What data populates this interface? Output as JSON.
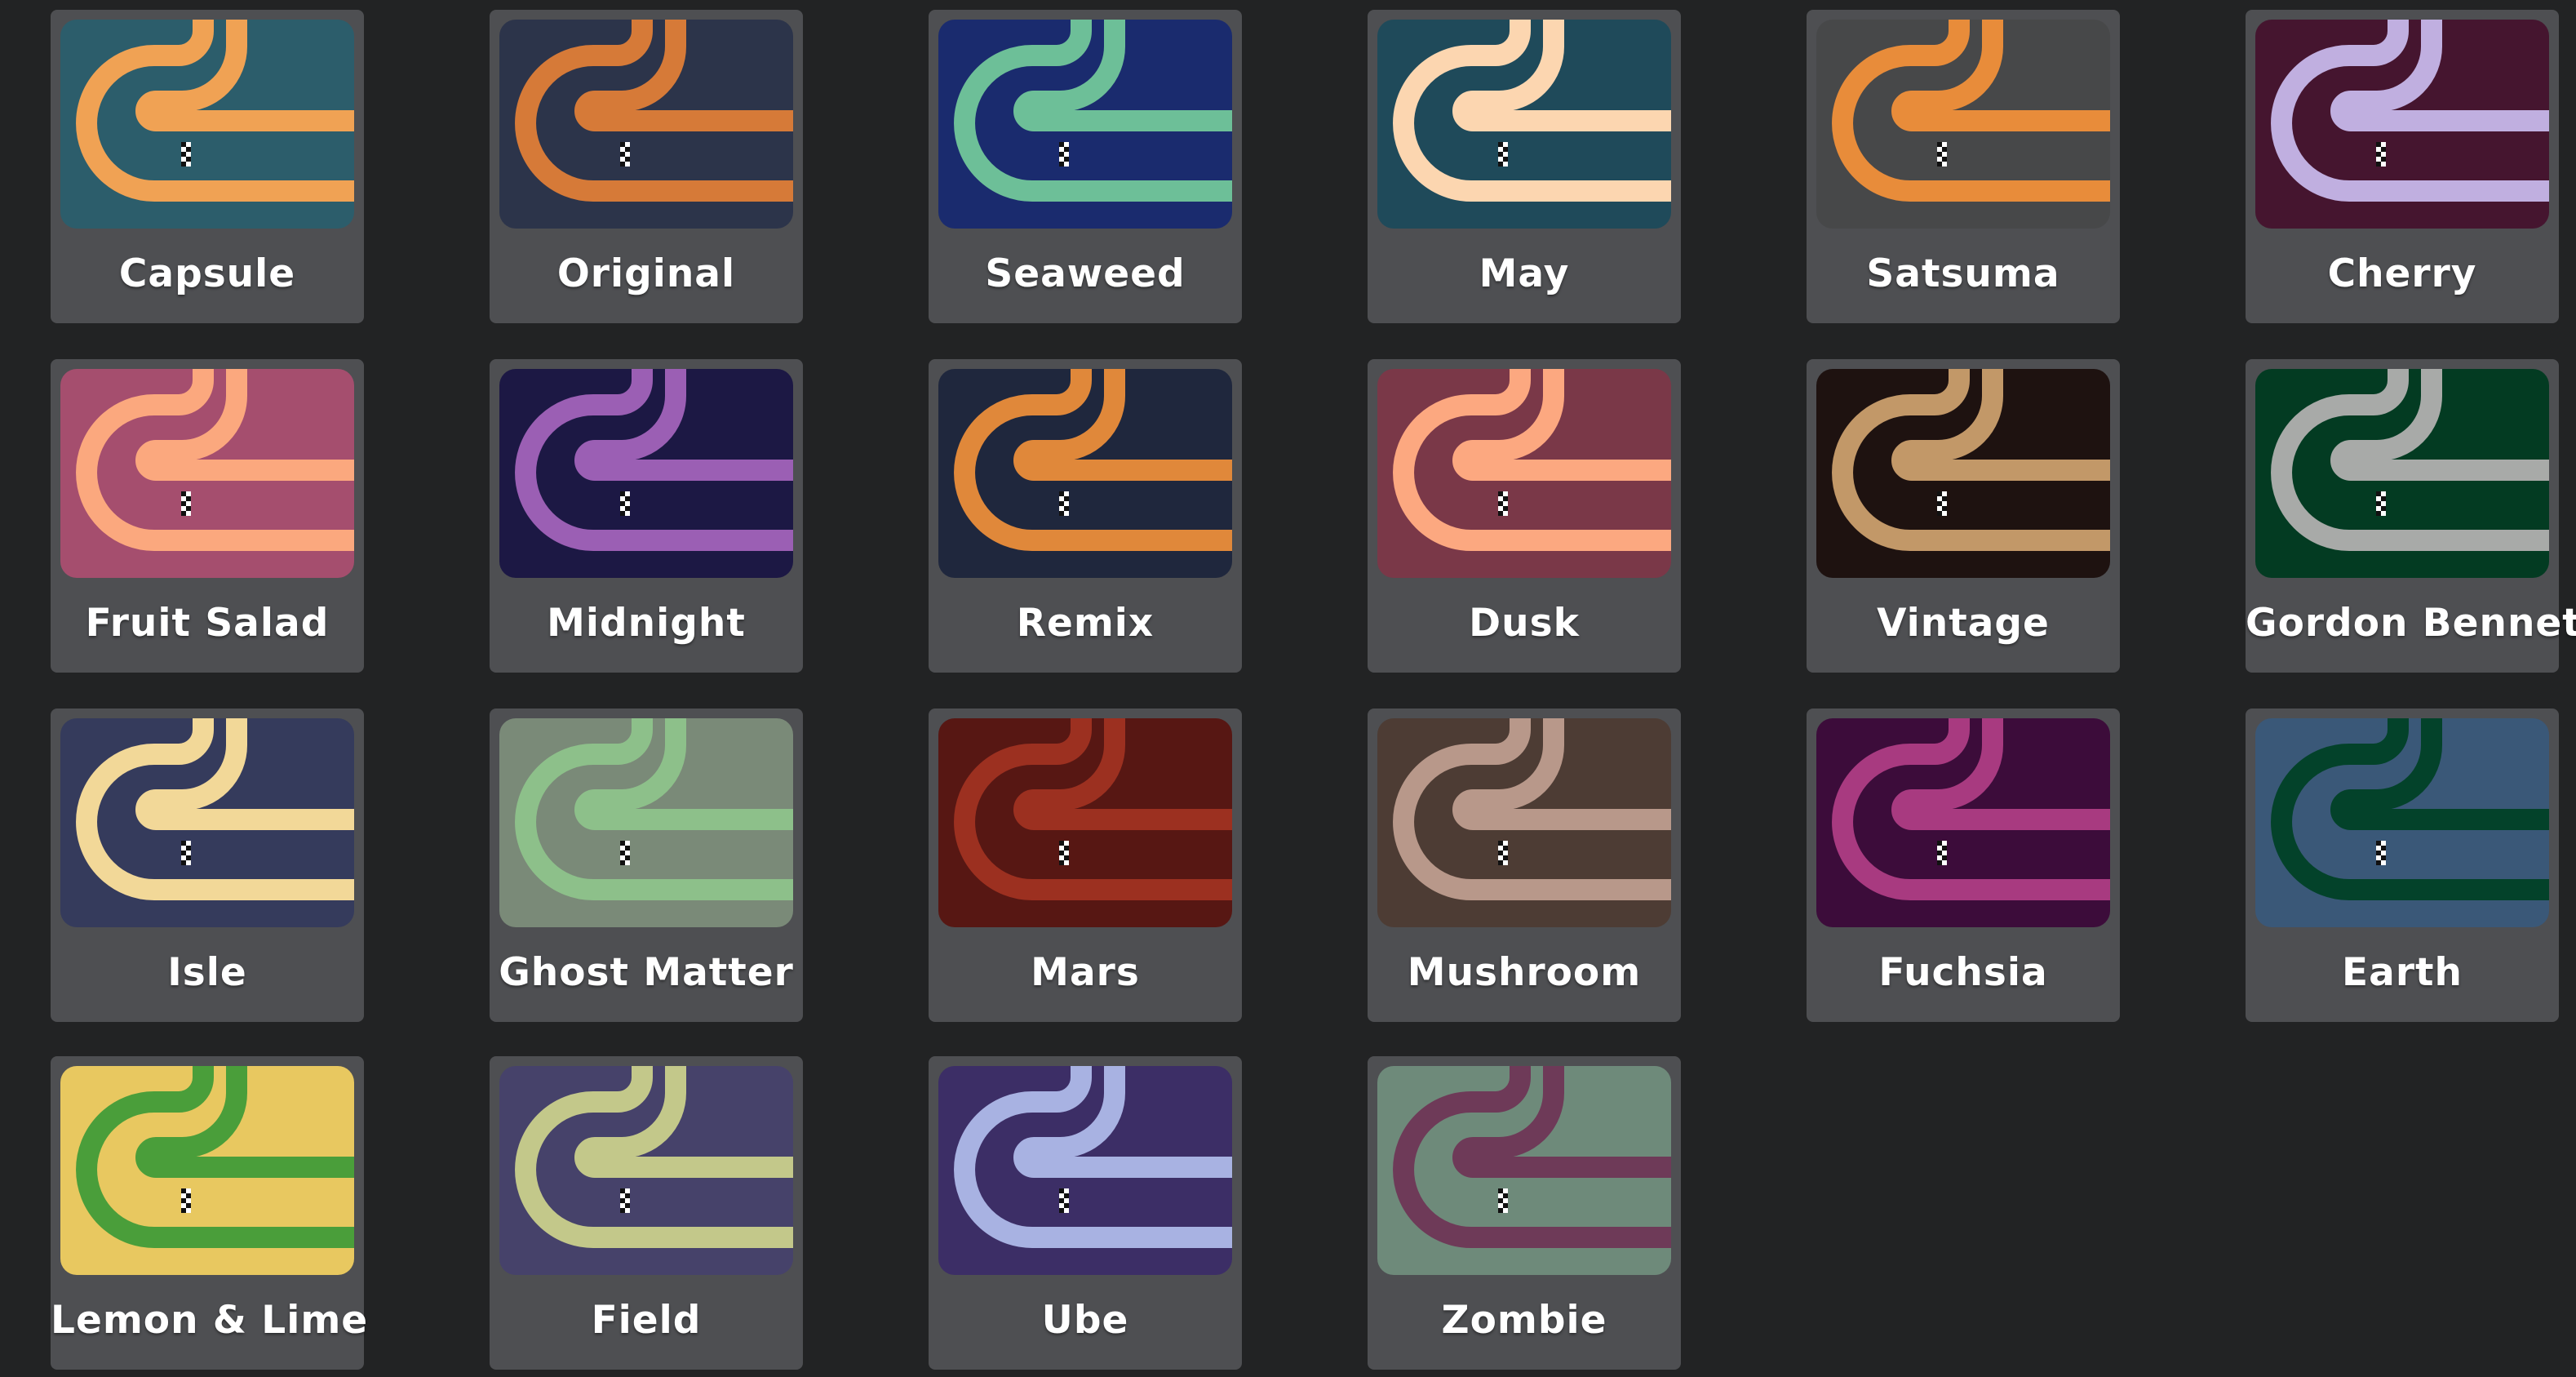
{
  "themes": [
    {
      "name": "Capsule",
      "bg": "#2c5d6b",
      "track": "#f0a254"
    },
    {
      "name": "Original",
      "bg": "#2c344a",
      "track": "#d67a38"
    },
    {
      "name": "Seaweed",
      "bg": "#1a2b6e",
      "track": "#6dbf98"
    },
    {
      "name": "May",
      "bg": "#1f4a5a",
      "track": "#fcd6b0"
    },
    {
      "name": "Satsuma",
      "bg": "#474849",
      "track": "#e88c3a"
    },
    {
      "name": "Cherry",
      "bg": "#45152f",
      "track": "#c0afe0"
    },
    {
      "name": "Fruit Salad",
      "bg": "#a54e6e",
      "track": "#fba87e"
    },
    {
      "name": "Midnight",
      "bg": "#1c1844",
      "track": "#9b5fb4"
    },
    {
      "name": "Remix",
      "bg": "#1f273d",
      "track": "#e0883a"
    },
    {
      "name": "Dusk",
      "bg": "#7a3848",
      "track": "#fca880"
    },
    {
      "name": "Vintage",
      "bg": "#1e1210",
      "track": "#c29868"
    },
    {
      "name": "Gordon Bennet",
      "bg": "#033b22",
      "track": "#a8aaa8"
    },
    {
      "name": "Isle",
      "bg": "#353b5c",
      "track": "#f2d898"
    },
    {
      "name": "Ghost Matter",
      "bg": "#7a8a78",
      "track": "#8dc08a"
    },
    {
      "name": "Mars",
      "bg": "#571713",
      "track": "#9c3020"
    },
    {
      "name": "Mushroom",
      "bg": "#4d3c34",
      "track": "#b8988a"
    },
    {
      "name": "Fuchsia",
      "bg": "#3c0c3a",
      "track": "#a83a80"
    },
    {
      "name": "Earth",
      "bg": "#3a5878",
      "track": "#03422a"
    },
    {
      "name": "Lemon & Lime",
      "bg": "#e8c860",
      "track": "#4a9e3a"
    },
    {
      "name": "Field",
      "bg": "#46426a",
      "track": "#c3c88a"
    },
    {
      "name": "Ube",
      "bg": "#3c2e66",
      "track": "#a8b2e2"
    },
    {
      "name": "Zombie",
      "bg": "#6e8a7a",
      "track": "#6e3a58"
    }
  ]
}
